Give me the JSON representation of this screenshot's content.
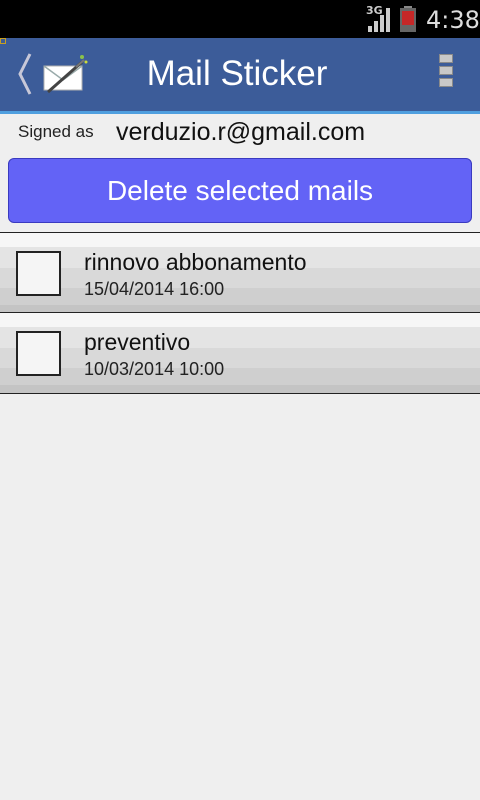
{
  "status_bar": {
    "network": "3G",
    "time": "4:38",
    "icons": [
      "signal-icon",
      "battery-icon"
    ]
  },
  "action_bar": {
    "title": "Mail Sticker",
    "icons": [
      "back-chevron-icon",
      "mail-sticker-logo-icon",
      "overflow-menu-icon"
    ],
    "colors": {
      "background": "#3c5c99",
      "divider": "#4f9fdf"
    }
  },
  "account": {
    "label": "Signed as",
    "email": "verduzio.r@gmail.com"
  },
  "actions": {
    "delete_label": "Delete selected mails",
    "delete_color": "#6363f6"
  },
  "mails": [
    {
      "subject": "rinnovo abbonamento",
      "date": "15/04/2014 16:00",
      "checked": false
    },
    {
      "subject": "preventivo",
      "date": "10/03/2014 10:00",
      "checked": false
    }
  ]
}
